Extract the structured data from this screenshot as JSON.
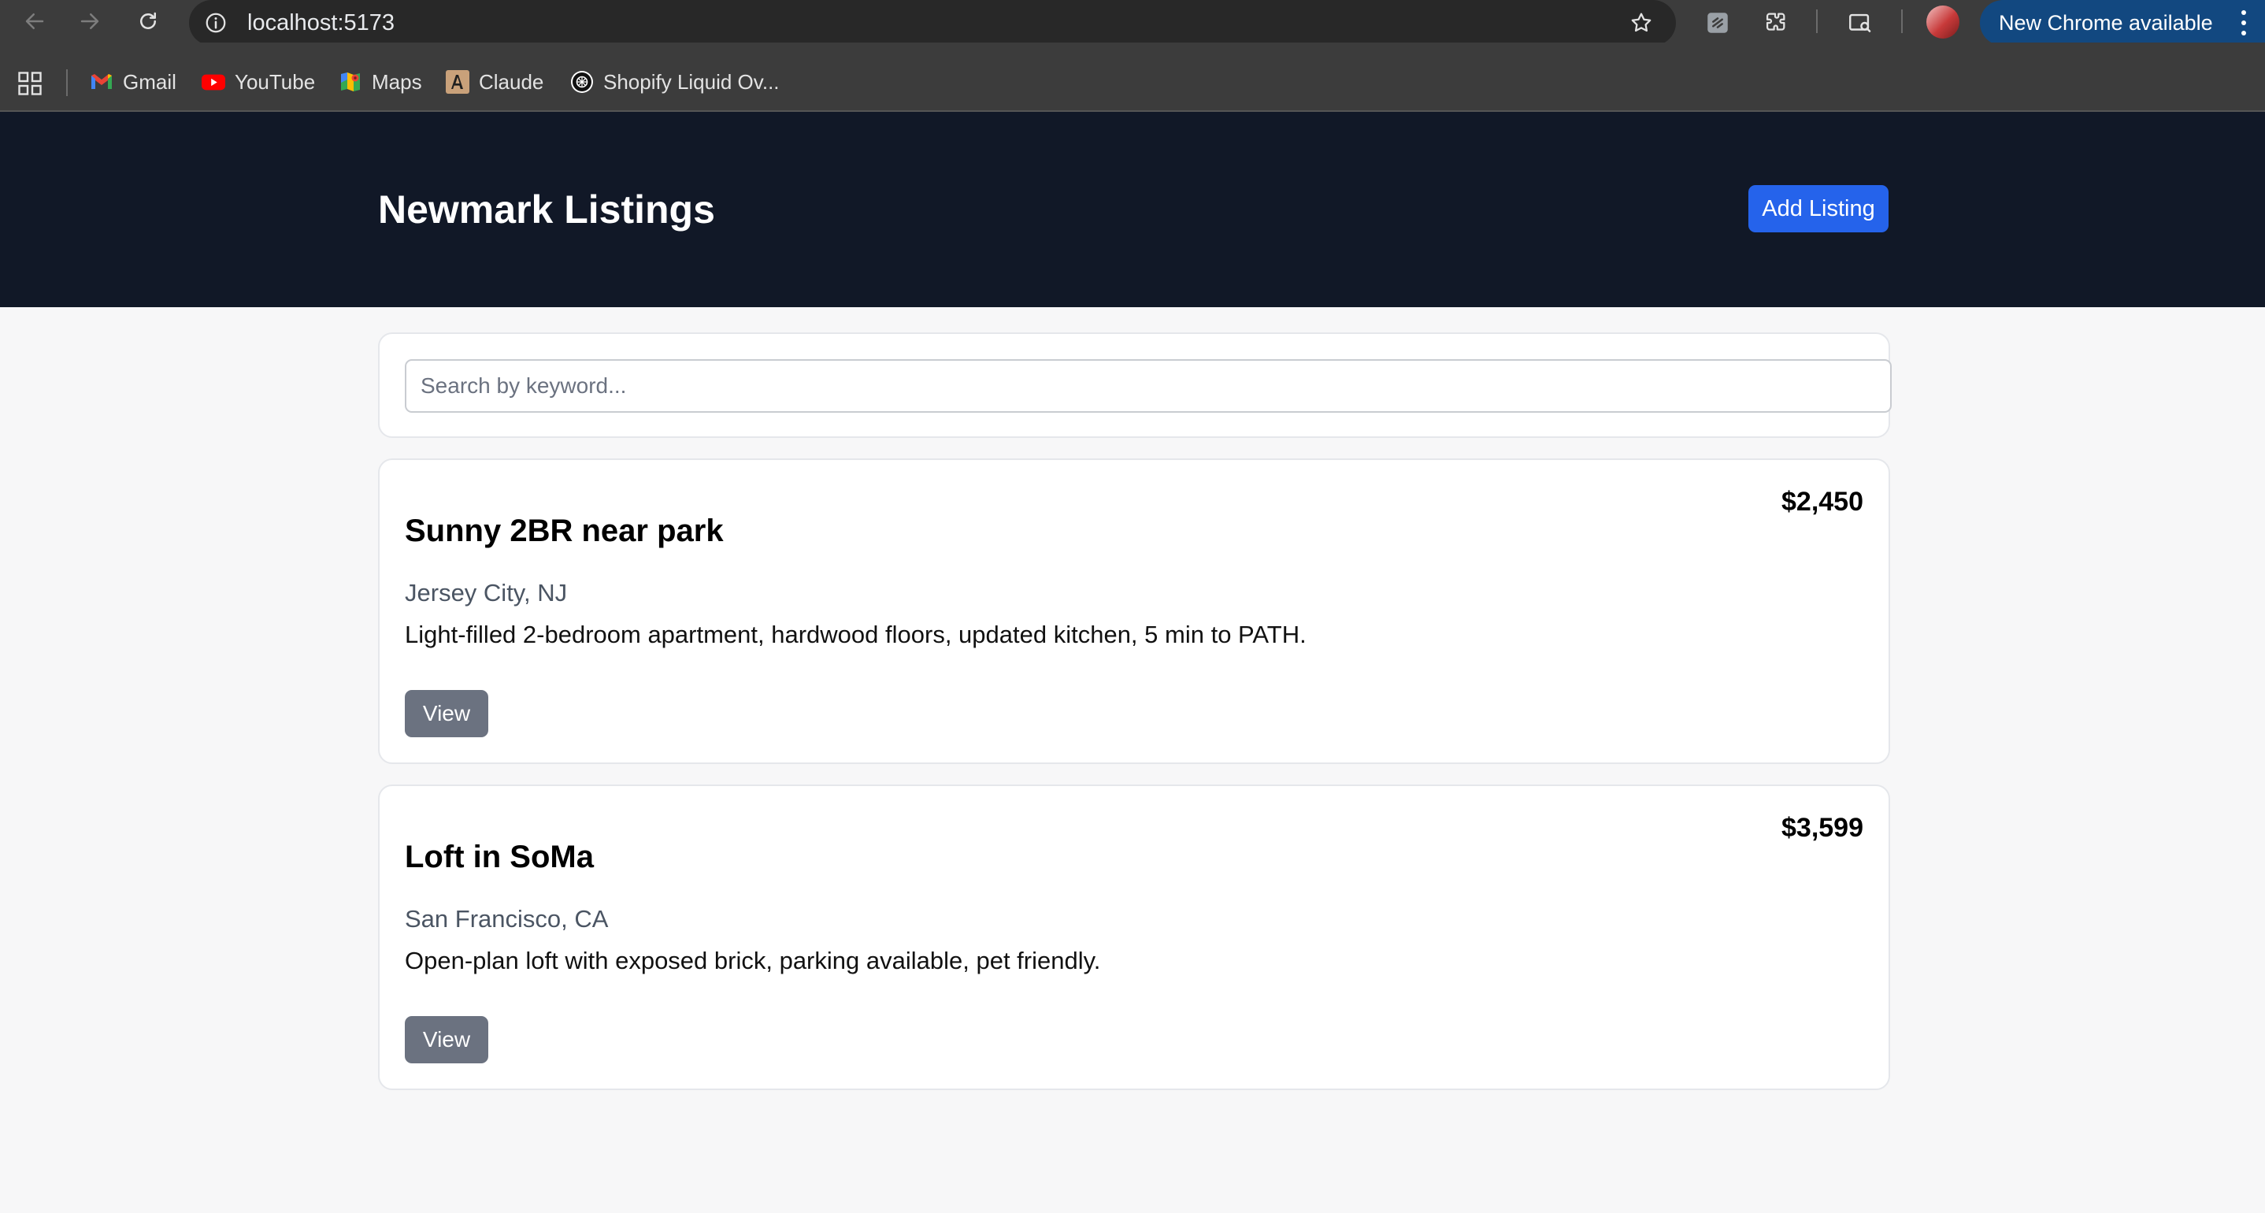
{
  "browser": {
    "url": "localhost:5173",
    "update_label": "New Chrome available",
    "bookmarks": [
      {
        "label": "Gmail",
        "icon": "gmail-icon"
      },
      {
        "label": "YouTube",
        "icon": "youtube-icon"
      },
      {
        "label": "Maps",
        "icon": "maps-icon"
      },
      {
        "label": "Claude",
        "icon": "claude-icon"
      },
      {
        "label": "Shopify Liquid Ov...",
        "icon": "shopify-icon"
      }
    ]
  },
  "header": {
    "title": "Newmark Listings",
    "add_button": "Add Listing"
  },
  "search": {
    "placeholder": "Search by keyword..."
  },
  "listings": [
    {
      "title": "Sunny 2BR near park",
      "price": "$2,450",
      "location": "Jersey City, NJ",
      "description": "Light-filled 2-bedroom apartment, hardwood floors, updated kitchen, 5 min to PATH.",
      "button": "View"
    },
    {
      "title": "Loft in SoMa",
      "price": "$3,599",
      "location": "San Francisco, CA",
      "description": "Open-plan loft with exposed brick, parking available, pet friendly.",
      "button": "View"
    }
  ],
  "colors": {
    "header_bg": "#111827",
    "primary_button": "#2563eb",
    "secondary_button": "#6b7280",
    "page_bg": "#f7f7f8"
  }
}
